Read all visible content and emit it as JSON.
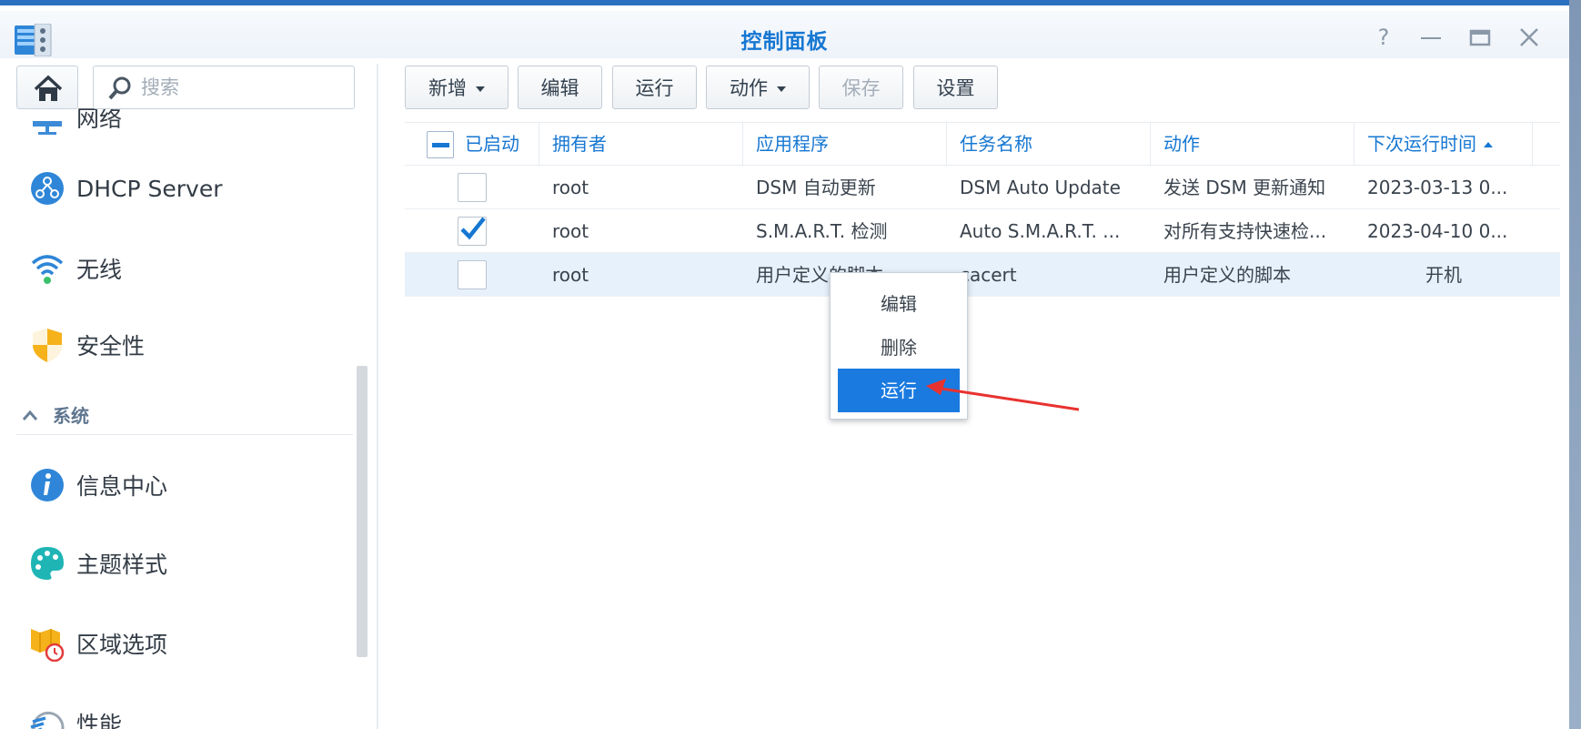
{
  "window": {
    "title": "控制面板"
  },
  "titlebar": {
    "help_icon": "help-icon",
    "minimize_icon": "minimize-icon",
    "maximize_icon": "maximize-icon",
    "close_icon": "close-icon"
  },
  "sidebar": {
    "search_placeholder": "搜索",
    "items": [
      {
        "label": "网络",
        "icon": "network-icon"
      },
      {
        "label": "DHCP Server",
        "icon": "dhcp-server-icon"
      },
      {
        "label": "无线",
        "icon": "wireless-icon"
      },
      {
        "label": "安全性",
        "icon": "security-shield-icon"
      }
    ],
    "section": {
      "label": "系统",
      "icon": "chevron-up-icon"
    },
    "system_items": [
      {
        "label": "信息中心",
        "icon": "info-icon"
      },
      {
        "label": "主题样式",
        "icon": "theme-palette-icon"
      },
      {
        "label": "区域选项",
        "icon": "regional-options-icon"
      },
      {
        "label": "性能",
        "icon": "performance-icon"
      }
    ]
  },
  "toolbar": {
    "create": "新增",
    "edit": "编辑",
    "run": "运行",
    "action": "动作",
    "save": "保存",
    "settings": "设置"
  },
  "table": {
    "columns": [
      "已启动",
      "拥有者",
      "应用程序",
      "任务名称",
      "动作",
      "下次运行时间"
    ],
    "rows": [
      {
        "enabled": false,
        "owner": "root",
        "app": "DSM 自动更新",
        "task": "DSM Auto Update",
        "action": "发送 DSM 更新通知",
        "next_run": "2023-03-13 0..."
      },
      {
        "enabled": true,
        "owner": "root",
        "app": "S.M.A.R.T. 检测",
        "task": "Auto S.M.A.R.T. ...",
        "action": "对所有支持快速检...",
        "next_run": "2023-04-10 0..."
      },
      {
        "enabled": false,
        "owner": "root",
        "app": "用户定义的脚本",
        "task": "cacert",
        "action": "用户定义的脚本",
        "next_run": "开机"
      }
    ]
  },
  "context_menu": {
    "items": [
      "编辑",
      "删除",
      "运行"
    ],
    "active": "运行"
  },
  "annotation": {
    "arrow_color": "#e8322f"
  }
}
